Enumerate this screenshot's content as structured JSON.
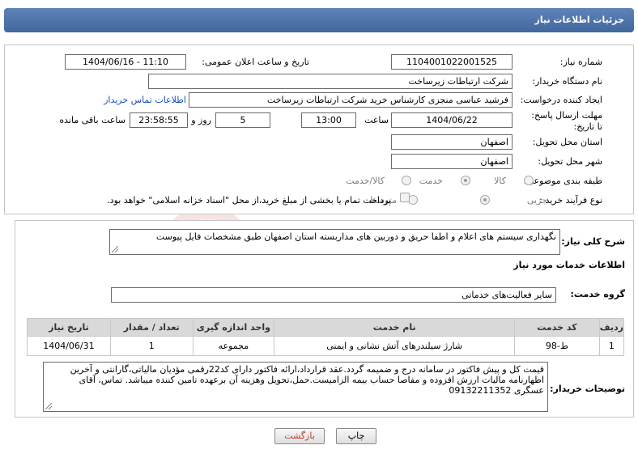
{
  "header": {
    "title": "جزئیات اطلاعات نیاز"
  },
  "form": {
    "need_number_label": "شماره نیاز:",
    "need_number": "1104001022001525",
    "announce_label": "تاریخ و ساعت اعلان عمومی:",
    "announce_value": "1404/06/16 - 11:10",
    "buyer_org_label": "نام دستگاه خریدار:",
    "buyer_org": "شرکت ارتباطات زیرساخت",
    "creator_label": "ایجاد کننده درخواست:",
    "creator": "فرشید عباسی منجزی کارشناس خرید شرکت ارتباطات زیرساخت",
    "contact_link": "اطلاعات تماس خریدار",
    "deadline_label": "مهلت ارسال پاسخ: تا تاریخ:",
    "deadline_date": "1404/06/22",
    "time_label": "ساعت",
    "deadline_time": "13:00",
    "days_value": "5",
    "days_label": "روز و",
    "remaining_time": "23:58:55",
    "remaining_label": "ساعت باقی مانده",
    "province_label": "استان محل تحویل:",
    "province": "اصفهان",
    "city_label": "شهر محل تحویل:",
    "city": "اصفهان",
    "category_label": "طبقه بندی موضوعی:",
    "category_options": [
      "کالا",
      "خدمت",
      "کالا/خدمت"
    ],
    "category_selected": "خدمت",
    "process_label": "نوع فرآیند خرید :",
    "process_options": [
      "جزیی",
      "متوسط"
    ],
    "process_selected": "جزیی",
    "treasury_note": "پرداخت تمام یا بخشی از مبلغ خرید،از محل \"اسناد خزانه اسلامی\" خواهد بود."
  },
  "summary": {
    "label": "شرح کلی نیاز:",
    "text": "نگهداری سیستم های اعلام و اطفا حریق و دوربین های مداربسته استان اصفهان طبق مشخصات فایل پیوست"
  },
  "services": {
    "section_title": "اطلاعات خدمات مورد نیاز",
    "group_label": "گروه خدمت:",
    "group_value": "سایر فعالیت‌های خدماتی",
    "table": {
      "headers": [
        "ردیف",
        "کد خدمت",
        "نام خدمت",
        "واحد اندازه گیری",
        "تعداد / مقدار",
        "تاریخ نیاز"
      ],
      "rows": [
        [
          "1",
          "ط-98",
          "شارژ سیلندرهای آتش نشانی و ایمنی",
          "مجموعه",
          "1",
          "1404/06/31"
        ]
      ]
    }
  },
  "notes": {
    "label": "توضیحات خریدار:",
    "text": "قیمت کل و پیش فاکتور در سامانه درج و ضمیمه گردد.عقد قرارداد،ارائه فاکتور دارای کد22رقمی مؤدیان مالیاتی،گارانتی و آخرین اظهارنامه مالیات ارزش افزوده و مفاصا حساب بیمه الزامیست.حمل،تحویل وهزینه آن برعهده تامین کننده میباشد. تماس، آقای عسگری 09132211352"
  },
  "buttons": {
    "print": "چاپ",
    "back": "بازگشت"
  },
  "watermark": {
    "brand": "AriaTender.neT"
  },
  "colors": {
    "header_bg": "#4a70a8",
    "link": "#1a4fb5",
    "watermark": "#c0392b"
  }
}
